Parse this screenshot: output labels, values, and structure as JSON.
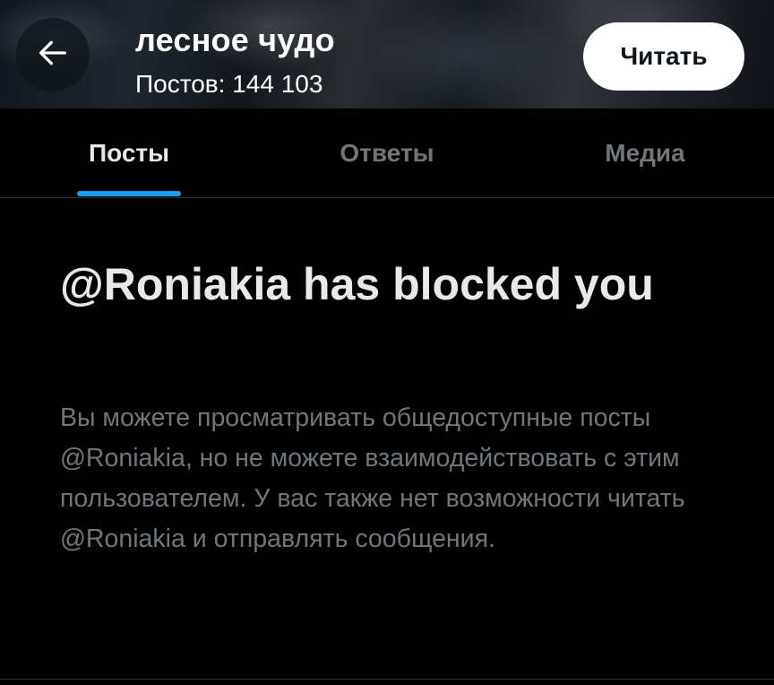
{
  "header": {
    "back_icon": "arrow-left-icon",
    "profile_name": "лесное чудо",
    "post_count": "Постов: 144 103",
    "follow_label": "Читать"
  },
  "tabs": [
    {
      "label": "Посты",
      "active": true
    },
    {
      "label": "Ответы",
      "active": false
    },
    {
      "label": "Медиа",
      "active": false
    }
  ],
  "blocked": {
    "title": "@Roniakia has blocked you",
    "description": "Вы можете просматривать общедоступные посты @Roniakia, но не можете взаимодействовать с этим пользователем. У вас также нет возможности читать @Roniakia и отправлять сообщения."
  },
  "colors": {
    "background": "#000000",
    "primary_text": "#e7e9ea",
    "secondary_text": "#71767b",
    "accent": "#1d9bf0",
    "divider": "#2f3336"
  }
}
